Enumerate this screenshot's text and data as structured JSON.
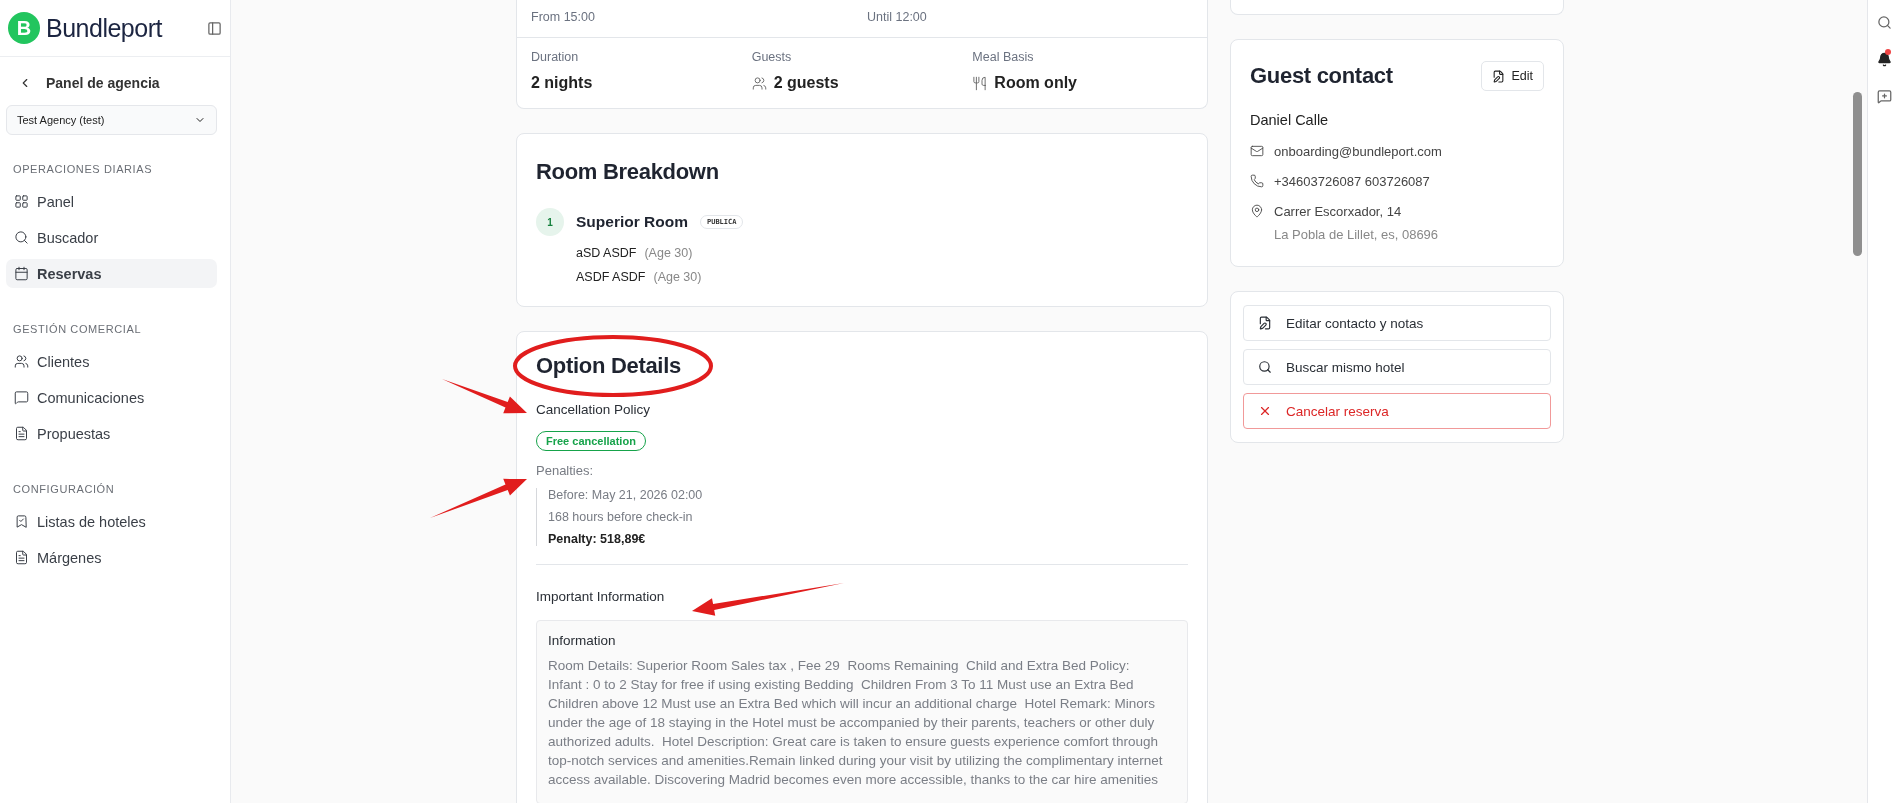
{
  "sidebar": {
    "logo_letter": "B",
    "brand": "Bundleport",
    "back_link": "Panel de agencia",
    "agency_select": {
      "value": "Test Agency (test)"
    },
    "sections": [
      {
        "heading": "OPERACIONES DIARIAS",
        "items": [
          {
            "label": "Panel",
            "selected": false
          },
          {
            "label": "Buscador",
            "selected": false
          },
          {
            "label": "Reservas",
            "selected": true
          }
        ]
      },
      {
        "heading": "GESTIÓN COMERCIAL",
        "items": [
          {
            "label": "Clientes",
            "selected": false
          },
          {
            "label": "Comunicaciones",
            "selected": false
          },
          {
            "label": "Propuestas",
            "selected": false
          }
        ]
      },
      {
        "heading": "CONFIGURACIÓN",
        "items": [
          {
            "label": "Listas de hoteles",
            "selected": false
          },
          {
            "label": "Márgenes",
            "selected": false
          }
        ]
      }
    ]
  },
  "stay_card": {
    "check_in_time": "From 15:00",
    "check_out_time": "Until 12:00",
    "details": [
      {
        "label": "Duration",
        "value": "2 nights"
      },
      {
        "label": "Guests",
        "value": "2 guests"
      },
      {
        "label": "Meal Basis",
        "value": "Room only"
      }
    ]
  },
  "room_breakdown": {
    "title": "Room Breakdown",
    "rooms": [
      {
        "number": "1",
        "name": "Superior Room",
        "tag": "PUBLICA",
        "guests": [
          {
            "name": "aSD ASDF",
            "age": "(Age 30)"
          },
          {
            "name": "ASDF ASDF",
            "age": "(Age 30)"
          }
        ]
      }
    ]
  },
  "option_details": {
    "title": "Option Details",
    "cancellation_heading": "Cancellation Policy",
    "cancellation_badge": "Free cancellation",
    "penalties_heading": "Penalties:",
    "penalty_before": "Before: May 21, 2026 02:00",
    "penalty_hours": "168 hours before check-in",
    "penalty_amount": "Penalty: 518,89€",
    "important_heading": "Important Information",
    "info_title": "Information",
    "info_text": "Room Details: Superior Room Sales tax , Fee 29  Rooms Remaining  Child and Extra Bed Policy:    Infant : 0 to 2 Stay for free if using existing Bedding  Children From 3 To 11 Must use an Extra Bed  Children above 12 Must use an Extra Bed which will incur an additional charge  Hotel Remark: Minors under the age of 18 staying in the Hotel must be accompanied by their parents, teachers or other duly authorized adults.  Hotel Description: Great care is taken to ensure guests experience comfort through top-notch services and amenities.Remain linked during your visit by utilizing the complimentary internet access available. Discovering Madrid becomes even more accessible, thanks to the car hire amenities"
  },
  "guest_contact": {
    "title": "Guest contact",
    "edit_button": "Edit",
    "name": "Daniel Calle",
    "email": "onboarding@bundleport.com",
    "phone": "+34603726087 603726087",
    "address_line": "Carrer Escorxador, 14",
    "address_city": "La Pobla de Lillet, es, 08696"
  },
  "actions": [
    {
      "label": "Editar contacto y notas",
      "kind": "edit"
    },
    {
      "label": "Buscar mismo hotel",
      "kind": "search"
    },
    {
      "label": "Cancelar reserva",
      "kind": "danger"
    }
  ],
  "rail": {
    "notifications_unread": true
  },
  "annotations": [
    {
      "kind": "ellipse"
    },
    {
      "kind": "arrow"
    },
    {
      "kind": "arrow"
    },
    {
      "kind": "arrow"
    }
  ]
}
